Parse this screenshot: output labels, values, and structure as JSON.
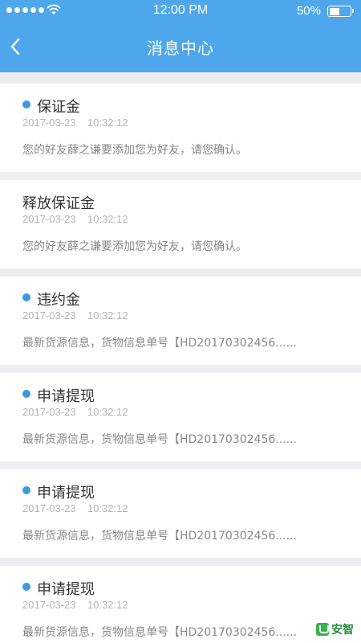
{
  "status_bar": {
    "time": "12:00 PM",
    "battery_text": "50%",
    "battery_level": 0.5,
    "signal_icon": "signal-dots-icon",
    "wifi_icon": "wifi-icon",
    "battery_icon": "battery-icon"
  },
  "nav": {
    "back_icon": "chevron-left-icon",
    "title": "消息中心"
  },
  "colors": {
    "header_blue": "#4ea7ea",
    "unread_dot": "#3d98e2",
    "background": "#eeeef2"
  },
  "messages": [
    {
      "title": "保证金",
      "date": "2017-03-23",
      "time": "10:32:12",
      "body": "您的好友薛之谦要添加您为好友，请您确认。",
      "unread": true
    },
    {
      "title": "释放保证金",
      "date": "2017-03-23",
      "time": "10:32:12",
      "body": "您的好友薛之谦要添加您为好友，请您确认。",
      "unread": false
    },
    {
      "title": "违约金",
      "date": "2017-03-23",
      "time": "10:32:12",
      "body": "最新货源信息，货物信息单号【HD20170302456......",
      "unread": true
    },
    {
      "title": "申请提现",
      "date": "2017-03-23",
      "time": "10:32:12",
      "body": "最新货源信息，货物信息单号【HD20170302456......",
      "unread": true
    },
    {
      "title": "申请提现",
      "date": "2017-03-23",
      "time": "10:32:12",
      "body": "最新货源信息，货物信息单号【HD20170302456......",
      "unread": true
    },
    {
      "title": "申请提现",
      "date": "2017-03-23",
      "time": "10:32:12",
      "body": "最新货源信息，货物信息单号【HD20170302456......",
      "unread": true
    }
  ],
  "watermark": {
    "text": "安智",
    "icon": "anzhi-logo-icon"
  }
}
